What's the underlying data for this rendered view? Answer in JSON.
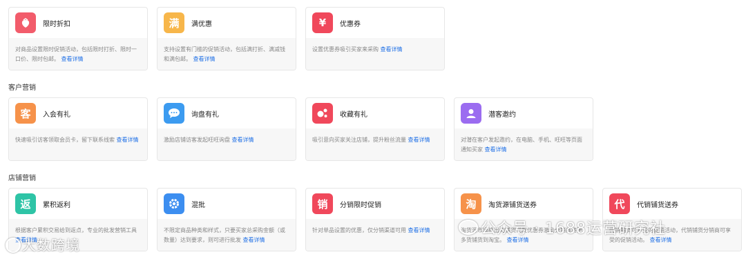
{
  "rows": [
    {
      "section_label": "",
      "cards": [
        {
          "title": "限时折扣",
          "icon": "strawberry-icon",
          "glyph": "",
          "color": "#f25c6b",
          "desc": "对商品设置限时促销活动，包括限时打折、限时一口价、限时包邮。",
          "link": "查看详情"
        },
        {
          "title": "满优惠",
          "icon": "man-character-icon",
          "glyph": "满",
          "color": "#f7b64a",
          "desc": "支持设置有门槛的促销活动，包括满打折、满减钱和满包邮。",
          "link": "查看详情"
        },
        {
          "title": "优惠券",
          "icon": "yen-coupon-icon",
          "glyph": "¥",
          "color": "#f0485b",
          "desc": "设置优惠券吸引买家来采购",
          "link": "查看详情"
        }
      ]
    },
    {
      "section_label": "客户营销",
      "cards": [
        {
          "title": "入会有礼",
          "icon": "ke-character-icon",
          "glyph": "客",
          "color": "#f6924a",
          "desc": "快速吸引访客领取会员卡，留下联系线索",
          "link": "查看详情"
        },
        {
          "title": "询盘有礼",
          "icon": "chat-bubble-icon",
          "glyph": "",
          "color": "#3c9bf0",
          "desc": "激励店铺访客发起旺旺询盘",
          "link": "查看详情"
        },
        {
          "title": "收藏有礼",
          "icon": "dots-icon",
          "glyph": "",
          "color": "#f0485b",
          "desc": "吸引意向买家关注店铺，提升粉丝流量",
          "link": "查看详情"
        },
        {
          "title": "潜客邀约",
          "icon": "user-icon",
          "glyph": "",
          "color": "#9b6cf0",
          "desc": "对潜在客户发起邀约，在电脑、手机、旺旺等页面通知买家",
          "link": "查看详情"
        }
      ]
    },
    {
      "section_label": "店铺营销",
      "cards": [
        {
          "title": "累积返利",
          "icon": "fan-character-icon",
          "glyph": "返",
          "color": "#2ec4a6",
          "desc": "根据客户累积交易给到返点，专业的批发营销工具",
          "link": "查看详情"
        },
        {
          "title": "混批",
          "icon": "gear-icon",
          "glyph": "",
          "color": "#3c8ef0",
          "desc": "不限定商品种类和样式，只要买家总采购金额（或数量）达到要求，则可进行批发",
          "link": "查看详情"
        },
        {
          "title": "分销限时促销",
          "icon": "xiao-character-icon",
          "glyph": "销",
          "color": "#f0485b",
          "desc": "针对单品设置的优惠，仅分销渠道可用",
          "link": "查看详情"
        },
        {
          "title": "淘货源铺货送券",
          "icon": "tao-character-icon",
          "glyph": "淘",
          "color": "#f6924a",
          "desc": "淘货源市场推出的铺货代发优惠券激励分销商将更多货铺货到淘宝。",
          "link": "查看详情"
        },
        {
          "title": "代销铺货送券",
          "icon": "dai-character-icon",
          "glyph": "代",
          "color": "#f0485b",
          "desc": "代销铺货可享受的促销活动，代销铺货分销商可享受的促销活动。",
          "link": "查看详情"
        }
      ]
    }
  ],
  "watermarks": {
    "left": "大数跨境",
    "right": "公众号 · 1688运营研究社"
  }
}
